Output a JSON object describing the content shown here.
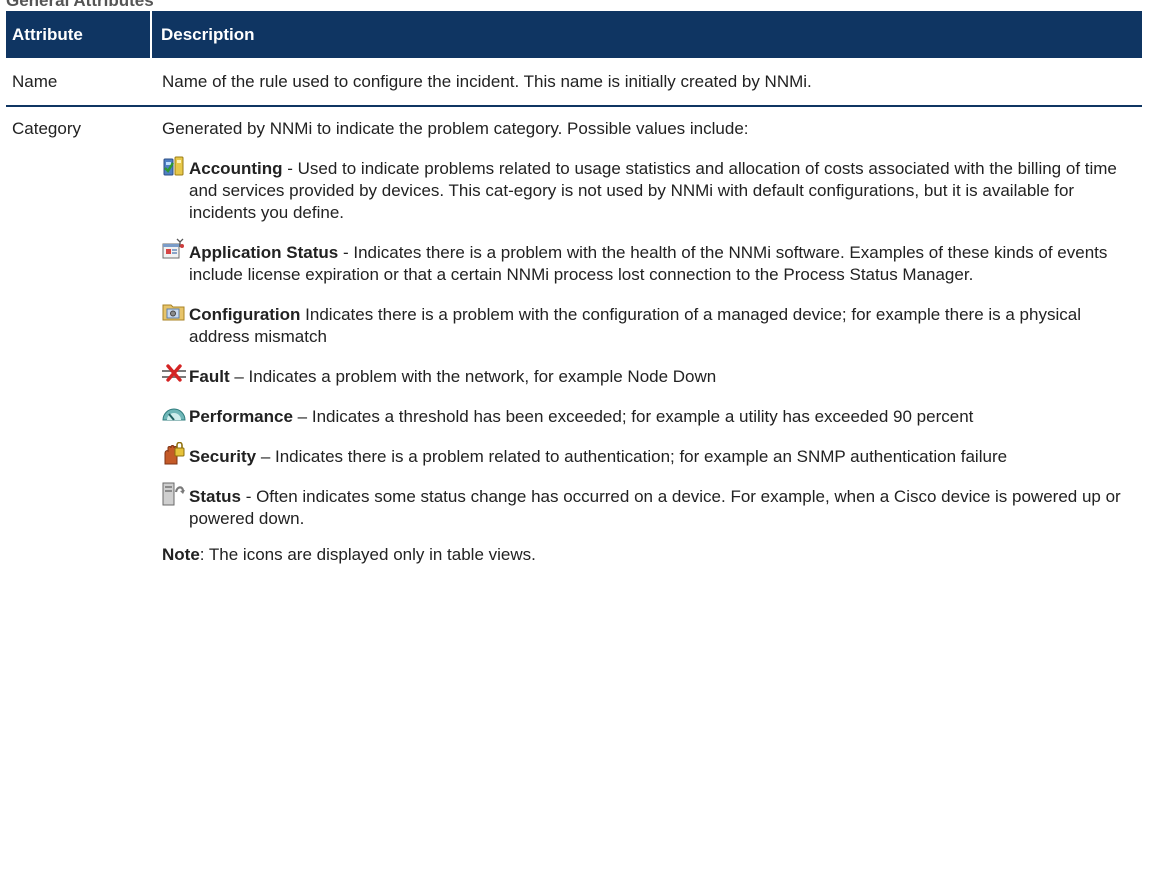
{
  "section_title": "General Attributes",
  "table": {
    "headers": [
      "Attribute",
      "Description"
    ],
    "rows": {
      "name": {
        "attribute": "Name",
        "description": "Name of the rule used to configure the incident. This name is initially created by NNMi."
      },
      "category": {
        "attribute": "Category",
        "intro": "Generated by NNMi to indicate the problem category. Possible values include:",
        "items": [
          {
            "icon": "accounting-icon",
            "name": "Accounting",
            "separator": " -  ",
            "text": "Used to indicate problems related to usage statistics and allocation of costs associated with the billing of time and services provided by devices. This cat-egory is not used by NNMi with default configurations, but it is available for incidents you define."
          },
          {
            "icon": "application-status-icon",
            "name": "Application Status",
            "separator": " - ",
            "text": "Indicates there is a problem with the health of the NNMi software. Examples of these kinds of events include license expiration or that a certain NNMi process lost connection to the Process Status Manager."
          },
          {
            "icon": "configuration-icon",
            "name": "Configuration",
            "separator": " ",
            "text": "Indicates there is a problem with the configuration of a managed device; for example there is a physical address mismatch"
          },
          {
            "icon": "fault-icon",
            "name": "Fault",
            "separator": " – ",
            "text": "Indicates a problem with the network, for example Node Down"
          },
          {
            "icon": "performance-icon",
            "name": "Performance",
            "separator": " – ",
            "text": "Indicates a threshold has been exceeded; for example a utility has exceeded 90 percent"
          },
          {
            "icon": "security-icon",
            "name": "Security",
            "separator": " –  ",
            "text": "Indicates there is a problem related to authentication; for example an SNMP authentication failure"
          },
          {
            "icon": "status-icon",
            "name": "Status",
            "separator": " - ",
            "text": "Often indicates some status change has occurred on a device. For example, when a Cisco device is powered up or powered down."
          }
        ],
        "note_label": "Note",
        "note_text": ": The icons are displayed only in table views."
      }
    }
  },
  "colors": {
    "header_bg": "#0f3562",
    "header_text": "#ffffff",
    "divider": "#0f3562"
  }
}
